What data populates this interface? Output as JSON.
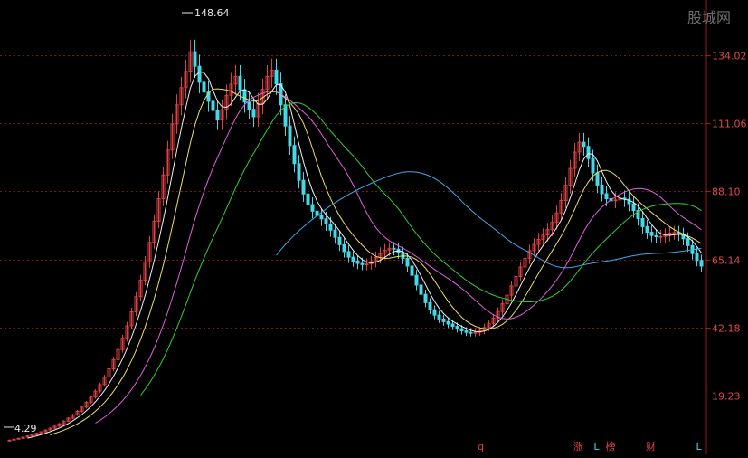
{
  "watermark": "股城网",
  "chart_data": {
    "type": "candlestick",
    "y_ticks": [
      "134.02",
      "111.06",
      "88.10",
      "65.14",
      "42.18",
      "19.23"
    ],
    "y_tick_values": [
      134.02,
      111.06,
      88.1,
      65.14,
      42.18,
      19.23
    ],
    "ylim": [
      -0.5,
      152.5
    ],
    "grid": true,
    "high_label": "148.64",
    "low_label": "4.29",
    "high_value": 148.64,
    "low_value": 4.29,
    "colors": {
      "up": "#e04040",
      "down": "#44d8e8",
      "ma5": "#f0f0f0",
      "ma10": "#f0e060",
      "ma20": "#e060e0",
      "ma30": "#30d030",
      "ma60": "#40a8e8",
      "grid": "#7a1818",
      "axis": "#a01818"
    },
    "moving_averages": [
      "ma5",
      "ma10",
      "ma20",
      "ma30",
      "ma60"
    ],
    "markers": [
      {
        "text": "q",
        "pos": 0.68,
        "color": "#e04040"
      },
      {
        "text": "涨",
        "pos": 0.82,
        "color": "#e04040"
      },
      {
        "text": "L",
        "pos": 0.846,
        "color": "#44d8e8"
      },
      {
        "text": "榜",
        "pos": 0.866,
        "color": "#e04040"
      },
      {
        "text": "财",
        "pos": 0.924,
        "color": "#e04040"
      },
      {
        "text": "L",
        "pos": 0.993,
        "color": "#44d8e8"
      }
    ],
    "close": [
      4.3,
      4.6,
      4.9,
      5.3,
      5.7,
      6.1,
      6.6,
      7.1,
      7.7,
      8.3,
      9.0,
      9.8,
      10.7,
      11.7,
      12.8,
      14.0,
      15.4,
      17.0,
      18.8,
      20.8,
      23.0,
      25.5,
      28.3,
      31.4,
      34.8,
      38.6,
      42.8,
      47.5,
      52.6,
      58.2,
      64.3,
      70.9,
      78.0,
      85.6,
      93.6,
      102.0,
      110.8,
      117.2,
      123.0,
      128.5,
      135.1,
      130.2,
      124.8,
      121.5,
      118.4,
      115.3,
      112.1,
      115.6,
      120.4,
      124.2,
      126.8,
      122.3,
      118.1,
      115.7,
      113.2,
      117.6,
      122.4,
      126.8,
      128.9,
      124.3,
      117.2,
      110.1,
      103.5,
      97.4,
      91.8,
      87.2,
      83.6,
      81.4,
      79.9,
      78.8,
      77.1,
      75.0,
      72.6,
      70.1,
      67.8,
      65.9,
      64.6,
      63.8,
      63.4,
      63.6,
      64.4,
      65.8,
      67.2,
      68.3,
      68.9,
      68.6,
      67.4,
      65.5,
      62.9,
      59.8,
      56.5,
      53.4,
      50.6,
      48.2,
      46.4,
      45.1,
      44.2,
      43.4,
      42.6,
      41.8,
      41.1,
      40.6,
      40.4,
      40.6,
      41.2,
      42.2,
      43.6,
      45.4,
      47.6,
      50.2,
      53.1,
      56.2,
      59.4,
      62.6,
      65.5,
      68.1,
      70.2,
      71.9,
      73.4,
      75.2,
      77.6,
      80.8,
      85.0,
      90.1,
      95.8,
      101.3,
      104.6,
      103.2,
      99.1,
      94.3,
      90.2,
      87.3,
      85.6,
      84.9,
      85.2,
      85.8,
      85.4,
      83.9,
      81.6,
      78.9,
      76.2,
      74.3,
      73.2,
      72.8,
      72.9,
      73.4,
      74.0,
      74.2,
      73.6,
      72.1,
      69.8,
      67.1,
      64.8,
      62.9
    ],
    "open": [
      4.2,
      4.3,
      4.6,
      4.9,
      5.3,
      5.7,
      6.1,
      6.6,
      7.1,
      7.7,
      8.3,
      9.0,
      9.8,
      10.7,
      11.7,
      12.8,
      14.0,
      15.4,
      17.0,
      18.8,
      20.8,
      23.0,
      25.5,
      28.3,
      31.4,
      34.8,
      38.6,
      42.8,
      47.5,
      52.6,
      58.2,
      64.3,
      70.9,
      78.0,
      85.6,
      93.6,
      102.0,
      110.8,
      117.2,
      123.0,
      128.5,
      135.1,
      130.2,
      124.8,
      121.5,
      118.4,
      115.3,
      112.1,
      115.6,
      120.4,
      124.2,
      126.8,
      122.3,
      118.1,
      115.7,
      113.2,
      117.6,
      122.4,
      126.8,
      128.9,
      124.3,
      117.2,
      110.1,
      103.5,
      97.4,
      91.8,
      87.2,
      83.6,
      81.4,
      79.9,
      78.8,
      77.1,
      75.0,
      72.6,
      70.1,
      67.8,
      65.9,
      64.6,
      63.8,
      63.4,
      63.6,
      64.4,
      65.8,
      67.2,
      68.3,
      68.9,
      68.6,
      67.4,
      65.5,
      62.9,
      59.8,
      56.5,
      53.4,
      50.6,
      48.2,
      46.4,
      45.1,
      44.2,
      43.4,
      42.6,
      41.8,
      41.1,
      40.6,
      40.4,
      40.6,
      41.2,
      42.2,
      43.6,
      45.4,
      47.6,
      50.2,
      53.1,
      56.2,
      59.4,
      62.6,
      65.5,
      68.1,
      70.2,
      71.9,
      73.4,
      75.2,
      77.6,
      80.8,
      85.0,
      90.1,
      95.8,
      101.3,
      104.6,
      103.2,
      99.1,
      94.3,
      90.2,
      87.3,
      85.6,
      84.9,
      85.2,
      85.8,
      85.4,
      83.9,
      81.6,
      78.9,
      76.2,
      74.3,
      73.2,
      72.8,
      72.9,
      73.4,
      74.0,
      74.2,
      73.6,
      72.1,
      69.8,
      67.1,
      64.8
    ]
  }
}
